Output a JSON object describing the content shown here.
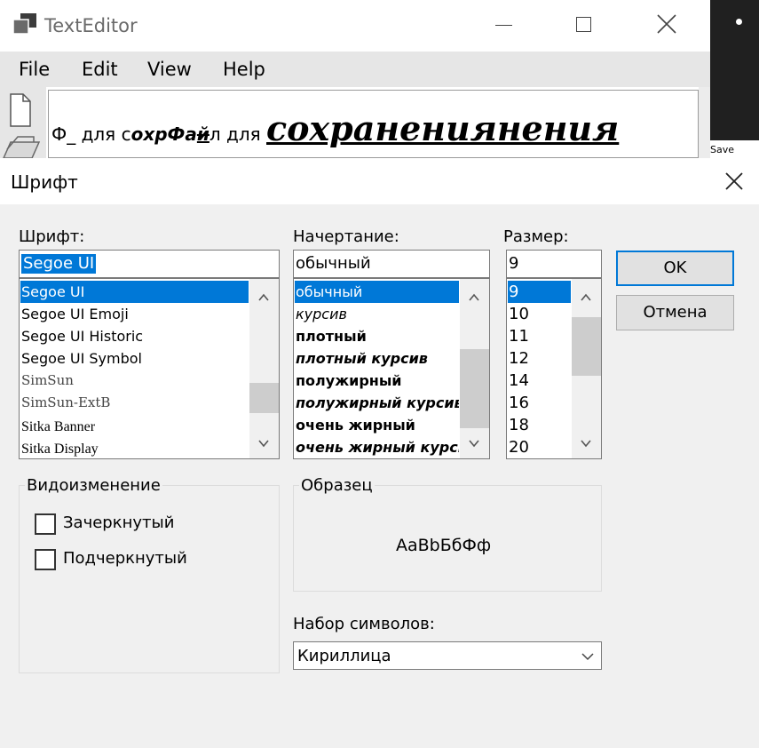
{
  "app": {
    "title": "TextEditor",
    "icon": "app-window-icon"
  },
  "menu": [
    "File",
    "Edit",
    "View",
    "Help"
  ],
  "document": {
    "seg1": "Ф_ для с",
    "seg2": "охрФа",
    "seg3": "й",
    "seg4": "л для ",
    "seg5": "сохранениянения"
  },
  "side_panel": {
    "save_label": "Save"
  },
  "dialog": {
    "title": "Шрифт",
    "font_label": "Шрифт:",
    "font_value": "Segoe UI",
    "fonts": [
      "Segoe UI",
      "Segoe UI Emoji",
      "Segoe UI Historic",
      "Segoe UI Symbol",
      "SimSun",
      "SimSun-ExtB",
      "Sitka Banner",
      "Sitka Display"
    ],
    "style_label": "Начертание:",
    "style_value": "обычный",
    "styles": [
      "обычный",
      "курсив",
      "плотный",
      "плотный курсив",
      "полужирный",
      "полужирный курсив",
      "очень жирный",
      "очень жирный курсив"
    ],
    "size_label": "Размер:",
    "size_value": "9",
    "sizes": [
      "9",
      "10",
      "11",
      "12",
      "14",
      "16",
      "18",
      "20"
    ],
    "ok_label": "OK",
    "cancel_label": "Отмена",
    "effects_label": "Видоизменение",
    "strikeout_label": "Зачеркнутый",
    "underline_label": "Подчеркнутый",
    "sample_label": "Образец",
    "sample_text": "AaBbБбФф",
    "charset_label": "Набор символов:",
    "charset_value": "Кириллица"
  },
  "colors": {
    "accent": "#0078d7",
    "dialog_bg": "#f0f0f0",
    "menubar_bg": "#e6e6e6"
  }
}
